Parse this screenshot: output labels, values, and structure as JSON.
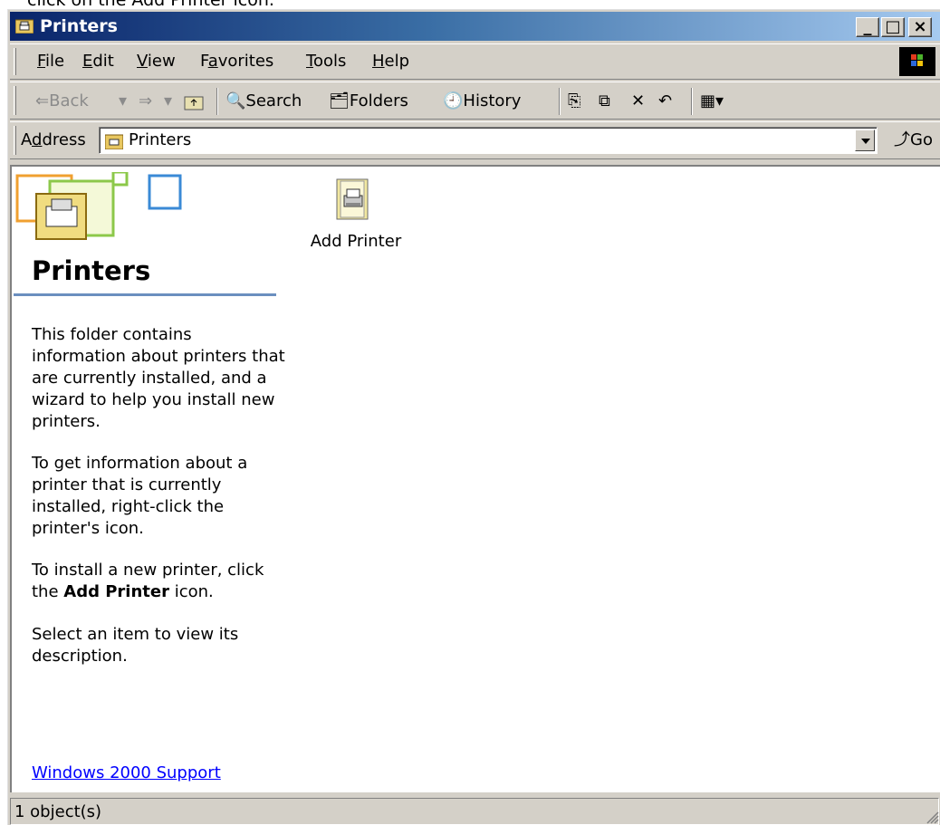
{
  "page_caption": "click on the Add Printer icon.",
  "window": {
    "title": "Printers",
    "buttons": {
      "minimize": "_",
      "maximize": "□",
      "close": "×"
    }
  },
  "menu": {
    "file": "F",
    "file_rest": "ile",
    "edit": "E",
    "edit_rest": "dit",
    "view": "V",
    "view_rest": "iew",
    "favorites_pre": "F",
    "favorites": "a",
    "favorites_rest": "vorites",
    "tools": "T",
    "tools_rest": "ools",
    "help": "H",
    "help_rest": "elp"
  },
  "toolbar": {
    "back": "Back",
    "search": "Search",
    "folders": "Folders",
    "history": "History"
  },
  "address": {
    "label_pre": "A",
    "label_u": "d",
    "label_rest": "dress",
    "value": "Printers",
    "go": "Go"
  },
  "panel": {
    "title": "Printers",
    "para1": "This folder contains information about printers that are currently installed, and a wizard to help you install new printers.",
    "para2": "To get information about a printer that is currently installed, right-click the printer's icon.",
    "para3_pre": "To install a new printer, click the ",
    "para3_bold": "Add Printer",
    "para3_post": " icon.",
    "para4": "Select an item to view its description.",
    "support_link": "Windows 2000 Support"
  },
  "items": [
    {
      "label": "Add Printer",
      "icon": "add-printer-icon"
    }
  ],
  "status": {
    "text": "1 object(s)"
  },
  "colors": {
    "title_start": "#0a246a",
    "title_end": "#a6caf0",
    "face": "#d4d0c8",
    "link": "#0000ff"
  }
}
